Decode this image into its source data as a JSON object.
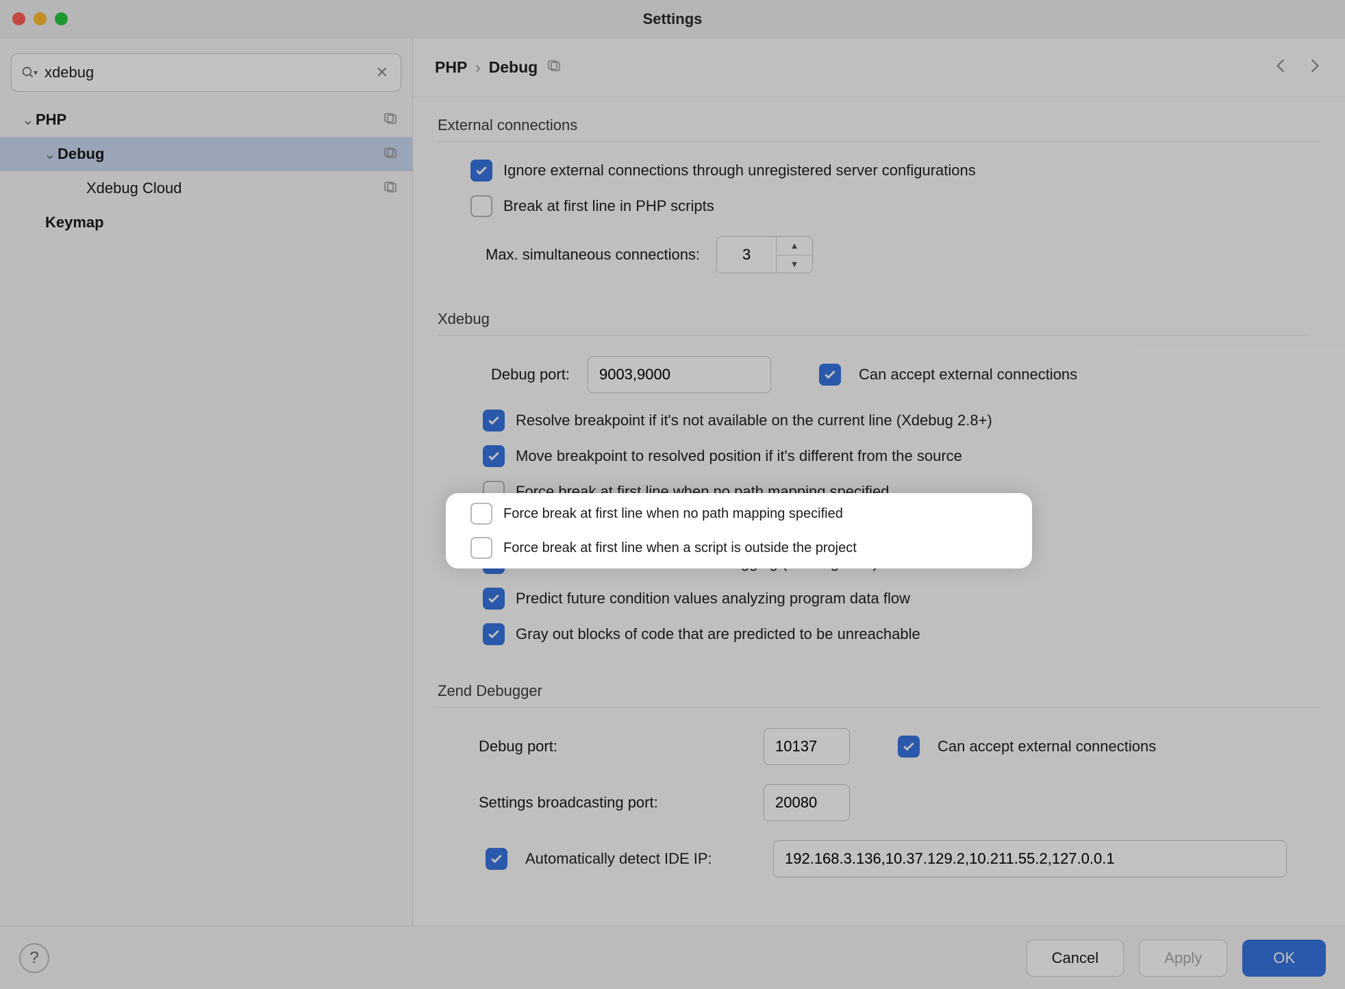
{
  "colors": {
    "accent": "#3874e0"
  },
  "window": {
    "title": "Settings"
  },
  "search": {
    "value": "xdebug"
  },
  "sidebar": {
    "items": [
      {
        "label": "PHP",
        "level": 0,
        "bold": true,
        "expanded": true,
        "project_scope": true
      },
      {
        "label": "Debug",
        "level": 1,
        "bold": true,
        "expanded": true,
        "selected": true,
        "project_scope": true
      },
      {
        "label": "Xdebug Cloud",
        "level": 2,
        "project_scope": true
      },
      {
        "label": "Keymap",
        "level": 0,
        "bold": true,
        "standalone": true
      }
    ]
  },
  "breadcrumb": {
    "parts": [
      "PHP",
      "Debug"
    ],
    "project_scope": true
  },
  "sections": {
    "external": {
      "title": "External connections",
      "ignore_unreg": {
        "checked": true,
        "label": "Ignore external connections through unregistered server configurations"
      },
      "break_first_php": {
        "checked": false,
        "label": "Break at first line in PHP scripts"
      },
      "max_conn_label": "Max. simultaneous connections:",
      "max_conn_value": "3"
    },
    "xdebug": {
      "title": "Xdebug",
      "port_label": "Debug port:",
      "port_value": "9003,9000",
      "can_accept": {
        "checked": true,
        "label": "Can accept external connections"
      },
      "resolve_bp": {
        "checked": true,
        "label": "Resolve breakpoint if it's not available on the current line (Xdebug 2.8+)"
      },
      "move_bp": {
        "checked": true,
        "label": "Move breakpoint to resolved position if it's different from the source"
      },
      "force_no_map": {
        "checked": false,
        "label": "Force break at first line when no path mapping specified"
      },
      "force_outside": {
        "checked": false,
        "label": "Force break at first line when a script is outside the project"
      },
      "enable_return": {
        "checked": true,
        "label": "Enable return function value debugging (Xdebug 3.2+)"
      },
      "predict": {
        "checked": true,
        "label": "Predict future condition values analyzing program data flow"
      },
      "gray_out": {
        "checked": true,
        "label": "Gray out blocks of code that are predicted to be unreachable"
      }
    },
    "zend": {
      "title": "Zend Debugger",
      "port_label": "Debug port:",
      "port_value": "10137",
      "can_accept": {
        "checked": true,
        "label": "Can accept external connections"
      },
      "broadcast_label": "Settings broadcasting port:",
      "broadcast_value": "20080",
      "auto_ide_ip": {
        "checked": true,
        "label": "Automatically detect IDE IP:"
      },
      "auto_ide_ip_value": "192.168.3.136,10.37.129.2,10.211.55.2,127.0.0.1"
    }
  },
  "footer": {
    "cancel": "Cancel",
    "apply": "Apply",
    "ok": "OK"
  }
}
